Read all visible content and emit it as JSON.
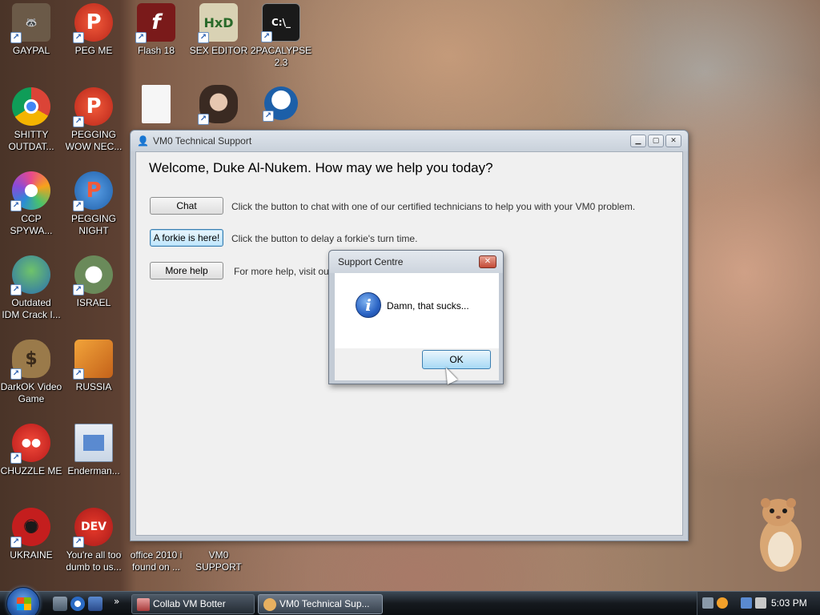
{
  "desktop": {
    "icons": [
      {
        "label": "GAYPAL",
        "glyph": "🦝",
        "color": "#6b5a48"
      },
      {
        "label": "PEG ME",
        "glyph": "P",
        "color": "#d6372a"
      },
      {
        "label": "Flash 18",
        "glyph": "f",
        "color": "#7a1a1a"
      },
      {
        "label": "SEX EDITOR",
        "glyph": "HxD",
        "color": "#d9d2b4"
      },
      {
        "label": "2PACALYPSE\n2.3",
        "glyph": "C:\\_",
        "color": "#1a1a1a"
      },
      {
        "label": "SHITTY\nOUTDAT...",
        "glyph": "◉",
        "color": "#2f9a4a"
      },
      {
        "label": "PEGGING\nWOW NEC...",
        "glyph": "P",
        "color": "#d6372a"
      },
      {
        "label": "",
        "glyph": "",
        "color": "#f6f6f6"
      },
      {
        "label": "",
        "glyph": "",
        "color": "#6b4a3a"
      },
      {
        "label": "",
        "glyph": "",
        "color": "#1c5fa8"
      },
      {
        "label": "CCP\nSPYWA...",
        "glyph": "✿",
        "color": "#c04bd0"
      },
      {
        "label": "PEGGING\nNIGHT",
        "glyph": "P",
        "color": "#3a7fc8"
      },
      {
        "label": "Outdated\nIDM Crack I...",
        "glyph": "◍",
        "color": "#2f8a3a"
      },
      {
        "label": "ISRAEL",
        "glyph": "❀",
        "color": "#7a9a6a"
      },
      {
        "label": "DarkOK Video\nGame",
        "glyph": "$",
        "color": "#8a6a3a"
      },
      {
        "label": "RUSSIA",
        "glyph": "▦",
        "color": "#d0892a"
      },
      {
        "label": "CHUZZLE ME",
        "glyph": "●",
        "color": "#d62a2a"
      },
      {
        "label": "Enderman...",
        "glyph": "▤",
        "color": "#dfe6ef"
      },
      {
        "label": "UKRAINE",
        "glyph": "☢",
        "color": "#c41e1e"
      },
      {
        "label": "You're all too\ndumb to us...",
        "glyph": "DEV",
        "color": "#c41e1e"
      },
      {
        "label": "office 2010 i\nfound on ...",
        "glyph": "",
        "color": "transparent"
      },
      {
        "label": "VM0\nSUPPORT",
        "glyph": "",
        "color": "transparent"
      }
    ]
  },
  "main_window": {
    "title": "VM0 Technical Support",
    "welcome": "Welcome, Duke Al-Nukem. How may we help you today?",
    "chat_button": "Chat",
    "chat_desc": "Click the button to chat with one of our certified technicians to help you with your VM0 problem.",
    "forkie_button": "A forkie is here!",
    "forkie_desc": "Click the button to delay a forkie's turn time.",
    "more_help_button": "More help",
    "more_help_desc": "For more help, visit our we"
  },
  "dialog": {
    "title": "Support Centre",
    "message": "Damn, that sucks...",
    "ok_label": "OK"
  },
  "taskbar": {
    "tasks": [
      {
        "label": "Collab VM Botter",
        "active": false
      },
      {
        "label": "VM0 Technical Sup...",
        "active": true
      }
    ],
    "clock": "5:03 PM",
    "more_arrow": "»"
  }
}
